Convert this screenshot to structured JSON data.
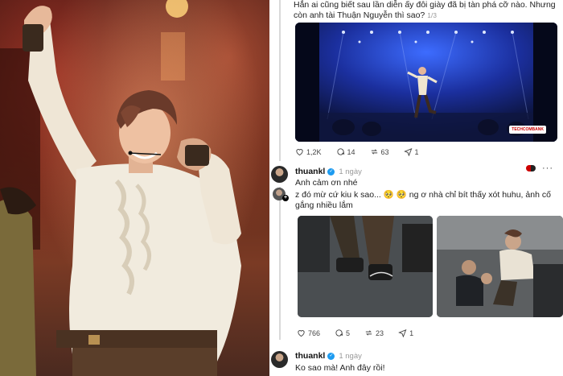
{
  "post": {
    "caption": "Hẳn ai cũng biết sau lần diễn ấy đôi giày đã bị tàn phá cỡ nào. Nhưng còn anh tài Thuận Nguyễn thì sao?",
    "pager": "1/3",
    "video_badge": "TECHCOMBANK",
    "stats": {
      "likes": "1,2K",
      "comments": "14",
      "reposts": "63",
      "shares": "1"
    }
  },
  "reply1": {
    "username": "thuankl",
    "time": "1 ngày",
    "quoted": "Anh cảm ơn nhé",
    "text": "z đó mừ cứ kiu k sao... 🥺 🥺  ng ơ nhà chỉ bít thấy xót huhu, ảnh cố gắng nhiều lắm",
    "stats": {
      "likes": "766",
      "comments": "5",
      "reposts": "23",
      "shares": "1"
    }
  },
  "reply2": {
    "username": "thuankl",
    "time": "1 ngày",
    "text": "Ko sao mà! Anh đây rồi!"
  },
  "colors": {
    "verified": "#1d9bf0",
    "divider": "#d9d9d9"
  }
}
